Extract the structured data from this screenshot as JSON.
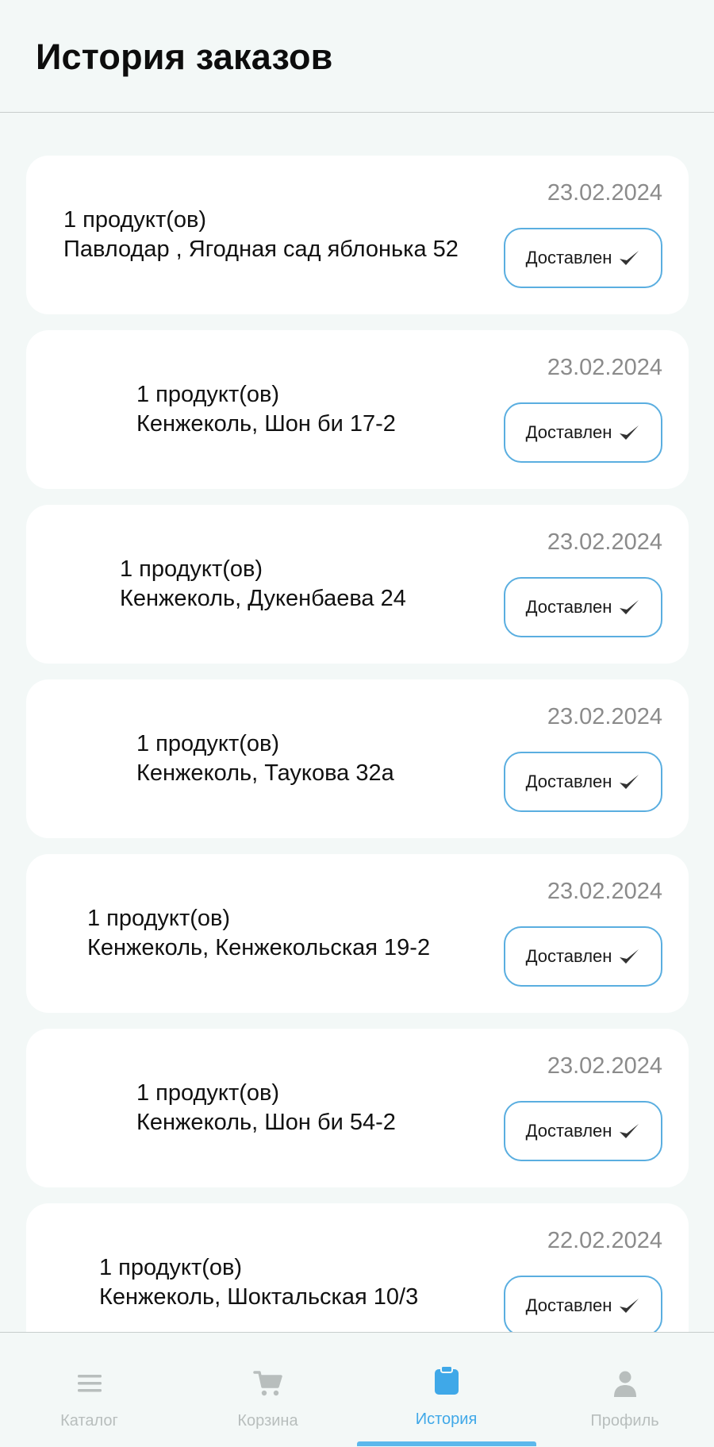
{
  "header": {
    "title": "История заказов"
  },
  "orders": [
    {
      "count": "1 продукт(ов)",
      "address": "Павлодар , Ягодная сад яблонька 52",
      "date": "23.02.2024",
      "status": "Доставлен"
    },
    {
      "count": "1 продукт(ов)",
      "address": "Кенжеколь, Шон би 17-2",
      "date": "23.02.2024",
      "status": "Доставлен"
    },
    {
      "count": "1 продукт(ов)",
      "address": "Кенжеколь, Дукенбаева 24",
      "date": "23.02.2024",
      "status": "Доставлен"
    },
    {
      "count": "1 продукт(ов)",
      "address": "Кенжеколь, Таукова 32а",
      "date": "23.02.2024",
      "status": "Доставлен"
    },
    {
      "count": "1 продукт(ов)",
      "address": "Кенжеколь, Кенжекольская 19-2",
      "date": "23.02.2024",
      "status": "Доставлен"
    },
    {
      "count": "1 продукт(ов)",
      "address": "Кенжеколь, Шон би 54-2",
      "date": "23.02.2024",
      "status": "Доставлен"
    },
    {
      "count": "1 продукт(ов)",
      "address": "Кенжеколь, Шоктальская 10/3",
      "date": "22.02.2024",
      "status": "Доставлен"
    }
  ],
  "nav": {
    "items": [
      {
        "label": "Каталог",
        "icon": "menu-icon"
      },
      {
        "label": "Корзина",
        "icon": "cart-icon"
      },
      {
        "label": "История",
        "icon": "clipboard-icon",
        "active": true
      },
      {
        "label": "Профиль",
        "icon": "profile-icon"
      }
    ]
  },
  "colors": {
    "accent": "#3fa8e8",
    "status_border": "#5aaee0",
    "background": "#f3f8f7",
    "inactive": "#b8bebd",
    "date_text": "#8b8b8b"
  }
}
